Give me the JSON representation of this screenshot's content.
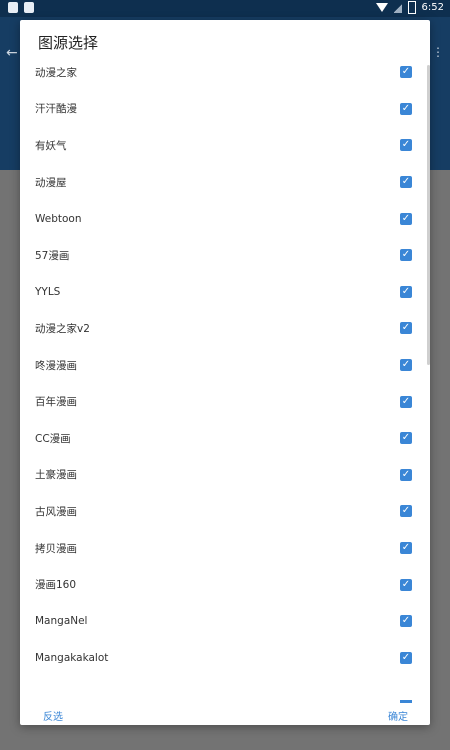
{
  "status_bar": {
    "time": "6:52"
  },
  "dialog": {
    "title": "图源选择",
    "items": [
      {
        "label": "动漫之家",
        "checked": true
      },
      {
        "label": "汗汗酷漫",
        "checked": true
      },
      {
        "label": "有妖气",
        "checked": true
      },
      {
        "label": "动漫屋",
        "checked": true
      },
      {
        "label": "Webtoon",
        "checked": true
      },
      {
        "label": "57漫画",
        "checked": true
      },
      {
        "label": "YYLS",
        "checked": true
      },
      {
        "label": "动漫之家v2",
        "checked": true
      },
      {
        "label": "咚漫漫画",
        "checked": true
      },
      {
        "label": "百年漫画",
        "checked": true
      },
      {
        "label": "CC漫画",
        "checked": true
      },
      {
        "label": "土豪漫画",
        "checked": true
      },
      {
        "label": "古风漫画",
        "checked": true
      },
      {
        "label": "拷贝漫画",
        "checked": true
      },
      {
        "label": "漫画160",
        "checked": true
      },
      {
        "label": "MangaNel",
        "checked": true
      },
      {
        "label": "Mangakakalot",
        "checked": true
      }
    ],
    "buttons": {
      "invert": "反选",
      "ok": "确定"
    }
  },
  "colors": {
    "accent": "#3a86d6",
    "status_bar": "#0e2f4f",
    "header": "#163d63",
    "scrim": "#737373"
  },
  "icons": [
    "notification-icon",
    "wifi-icon",
    "signal-icon",
    "battery-icon",
    "checkbox-checked-icon"
  ]
}
